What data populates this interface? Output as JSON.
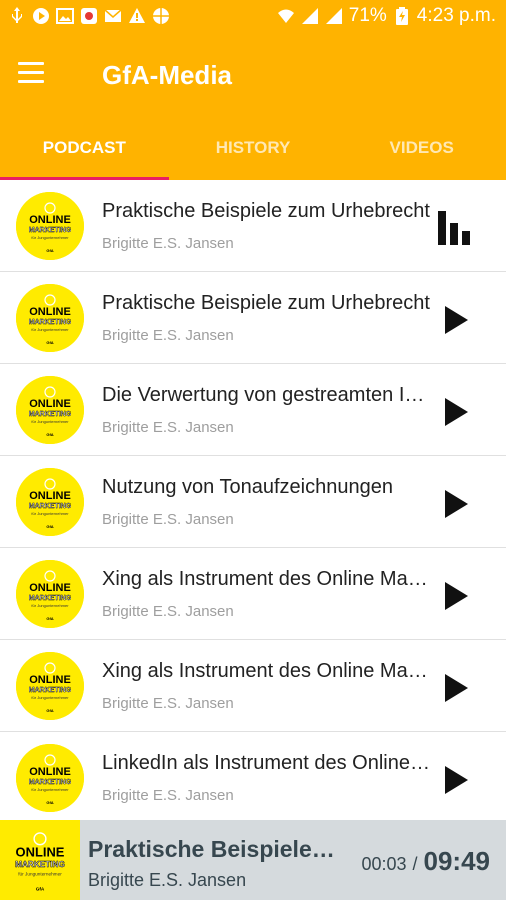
{
  "status_bar": {
    "left_icons": [
      "usb-icon",
      "youtube-icon",
      "image-icon",
      "app-icon",
      "mail-icon",
      "warning-icon",
      "vpn-icon"
    ],
    "right_icons": [
      "wifi-icon",
      "signal-icon",
      "signal-icon"
    ],
    "battery": "71%",
    "time": "4:23 p.m."
  },
  "app_bar": {
    "title": "GfA-Media",
    "menu_icon": "hamburger-icon"
  },
  "tabs": [
    {
      "label": "PODCAST",
      "active": true
    },
    {
      "label": "HISTORY",
      "active": false
    },
    {
      "label": "VIDEOS",
      "active": false
    }
  ],
  "episodes": [
    {
      "title": "Praktische Beispiele zum Urhebrecht",
      "author": "Brigitte E.S. Jansen",
      "action_icon": "equalizer-icon"
    },
    {
      "title": "Praktische Beispiele zum Urhebrecht",
      "author": "Brigitte E.S. Jansen",
      "action_icon": "play-icon"
    },
    {
      "title": "Die Verwertung von gestreamten Inhalten",
      "author": "Brigitte E.S. Jansen",
      "action_icon": "play-icon"
    },
    {
      "title": "Nutzung von Tonaufzeichnungen",
      "author": "Brigitte E.S. Jansen",
      "action_icon": "play-icon"
    },
    {
      "title": "Xing als Instrument des Online Marketings",
      "author": "Brigitte E.S. Jansen",
      "action_icon": "play-icon"
    },
    {
      "title": "Xing als Instrument des Online Marketings",
      "author": "Brigitte E.S. Jansen",
      "action_icon": "play-icon"
    },
    {
      "title": "LinkedIn als Instrument des Online Marketings",
      "author": "Brigitte E.S. Jansen",
      "action_icon": "play-icon"
    }
  ],
  "logo": {
    "line1": "ONLINE",
    "line2": "MARKETING",
    "line3": "für Jungunternehmer",
    "line4": "GfA"
  },
  "player": {
    "title": "Praktische Beispiele zum Urhebrecht",
    "author": "Brigitte E.S. Jansen",
    "current_time": "00:03",
    "separator": "/",
    "total_time": "09:49"
  },
  "colors": {
    "accent": "#ffb300",
    "tab_indicator": "#e91e63",
    "logo_yellow": "#ffeb00",
    "player_bg": "#d5dadd"
  }
}
